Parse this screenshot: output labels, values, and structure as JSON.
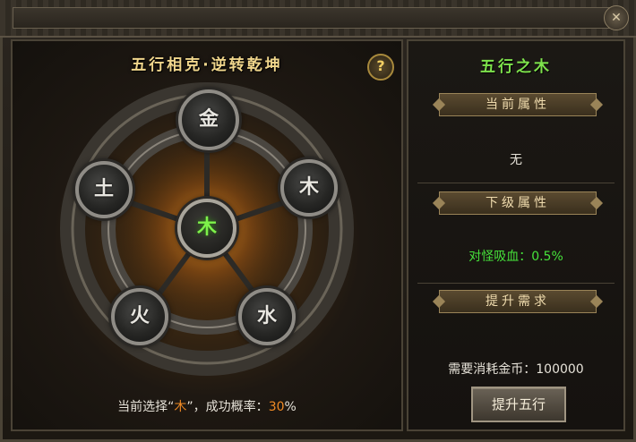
{
  "window": {
    "close_glyph": "✕"
  },
  "left": {
    "title": "五行相克·逆转乾坤",
    "help_glyph": "?",
    "nodes": {
      "top": "金",
      "right": "木",
      "bottom_right": "水",
      "bottom_left": "火",
      "left": "土",
      "center": "木"
    },
    "status": {
      "prefix": "当前选择“",
      "element": "木",
      "middle": "”，成功概率：",
      "rate": "30",
      "suffix": "%"
    }
  },
  "right": {
    "title": "五行之木",
    "current_attr_label": "当前属性",
    "current_attr_value": "无",
    "next_attr_label": "下级属性",
    "next_attr_value": "对怪吸血：0.5%",
    "requirement_label": "提升需求",
    "cost_text": "需要消耗金币：100000",
    "upgrade_button": "提升五行"
  },
  "colors": {
    "title_gold": "#f0d68c",
    "title_green": "#7ee24c",
    "attr_green": "#46e23a",
    "highlight_orange": "#f08a24"
  }
}
